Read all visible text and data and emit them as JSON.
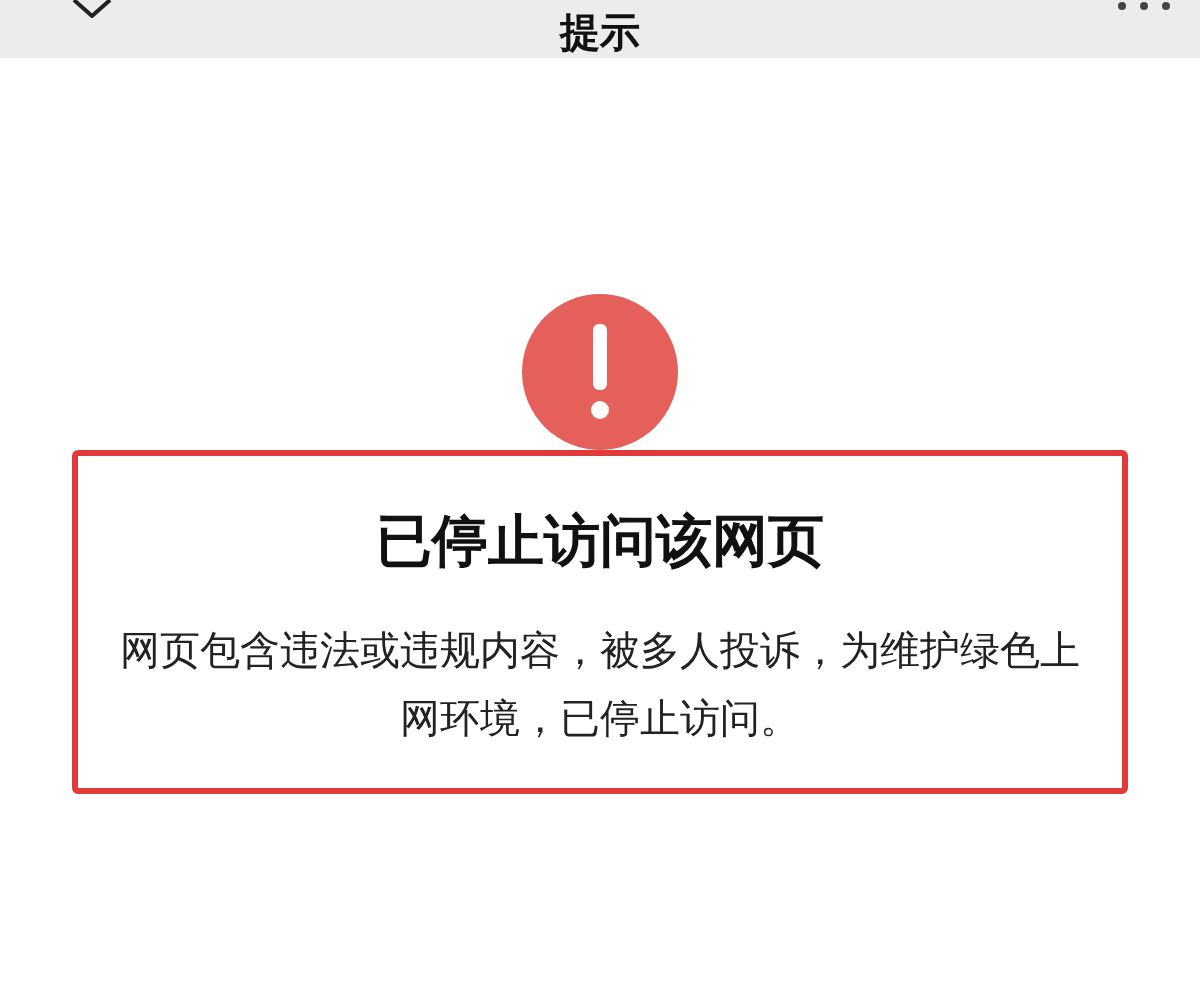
{
  "nav_bar": {
    "title": "提示"
  },
  "notice": {
    "title": "已停止访问该网页",
    "message": "网页包含违法或违规内容，被多人投诉，为维护绿色上网环境，已停止访问。"
  }
}
